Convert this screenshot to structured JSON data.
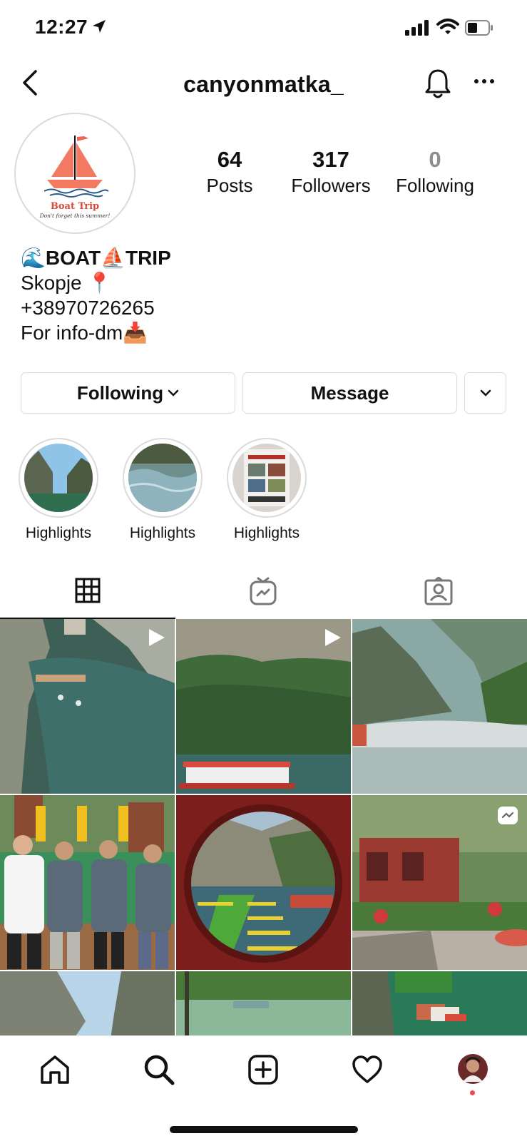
{
  "status_bar": {
    "time": "12:27"
  },
  "nav": {
    "username": "canyonmatka_"
  },
  "avatar": {
    "brand": "Boat Trip",
    "tagline": "Don't forget this summer!"
  },
  "stats": [
    {
      "value": "64",
      "label": "Posts"
    },
    {
      "value": "317",
      "label": "Followers"
    },
    {
      "value": "0",
      "label": "Following"
    }
  ],
  "bio": {
    "name": "🌊BOAT⛵TRIP",
    "line1": "Skopje 📍",
    "line2": "+38970726265",
    "line3": "For info-dm📥"
  },
  "actions": {
    "following": "Following",
    "message": "Message"
  },
  "highlights": [
    {
      "label": "Highlights"
    },
    {
      "label": "Highlights"
    },
    {
      "label": "Highlights"
    }
  ],
  "tabs": [
    "grid-icon",
    "igtv-icon",
    "tagged-icon"
  ],
  "bottom_nav": [
    "home-icon",
    "search-icon",
    "new-post-icon",
    "activity-icon",
    "profile-avatar"
  ],
  "colors": {
    "accent_red": "#ed4956",
    "divider": "#dbdbdb",
    "muted": "#8e8e8e"
  }
}
